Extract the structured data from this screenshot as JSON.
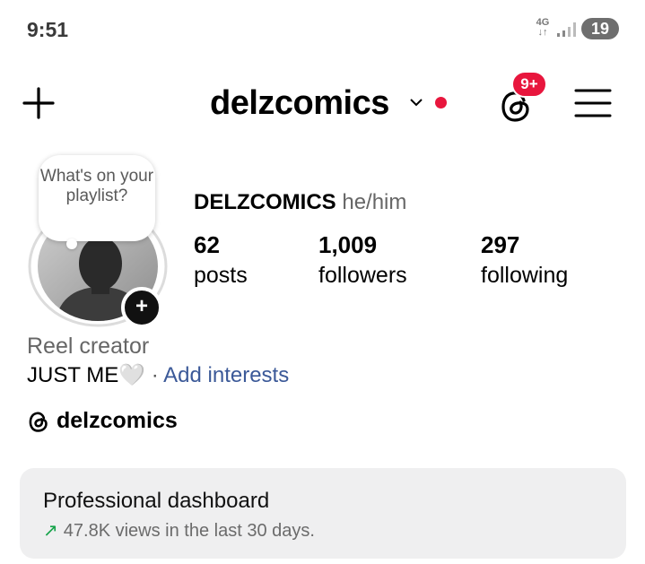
{
  "status_bar": {
    "time": "9:51",
    "network": "4G",
    "battery": "19"
  },
  "header": {
    "username": "delzcomics",
    "notifications_badge": "9+"
  },
  "profile": {
    "note_text": "What's on your playlist?",
    "full_name": "DELZCOMICS",
    "pronouns": "he/him",
    "stats": [
      {
        "value": "62",
        "label": "posts"
      },
      {
        "value": "1,009",
        "label": "followers"
      },
      {
        "value": "297",
        "label": "following"
      }
    ],
    "category": "Reel creator",
    "bio": "JUST ME",
    "bio_emoji": "🤍",
    "bio_separator": "·",
    "add_interests": "Add interests",
    "threads_handle": "delzcomics"
  },
  "dashboard": {
    "title": "Professional dashboard",
    "subtitle": "47.8K views in the last 30 days."
  },
  "colors": {
    "accent_red": "#e8163d",
    "link_blue": "#3b5998",
    "trend_green": "#16a34a",
    "card_bg": "#efeff0"
  }
}
